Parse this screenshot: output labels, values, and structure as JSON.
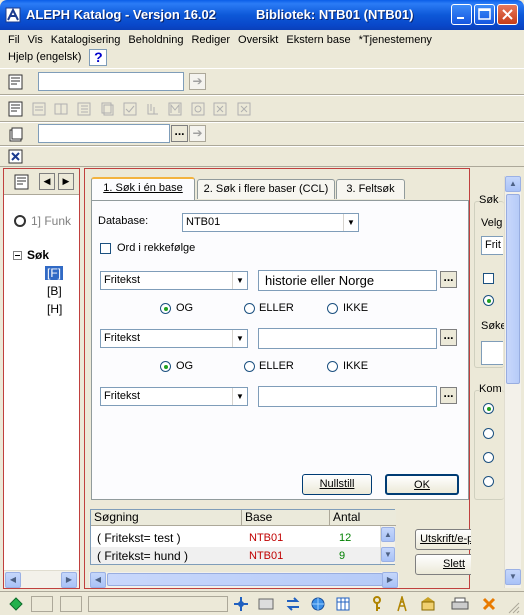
{
  "window": {
    "title": "ALEPH Katalog - Versjon 16.02",
    "library": "Bibliotek:  NTB01 (NTB01)"
  },
  "menu": {
    "items": [
      "Fil",
      "Vis",
      "Katalogisering",
      "Beholdning",
      "Rediger",
      "Oversikt",
      "Ekstern base",
      "*Tjenestemeny"
    ],
    "help": "Hjelp (engelsk)",
    "help_button": "?"
  },
  "left_panel": {
    "func_label": "1] Funk",
    "tree_root": "Søk",
    "tree_items": [
      "[F]",
      "[B]",
      "[H]"
    ]
  },
  "tabs": [
    "1. Søk i én base",
    "2. Søk i flere baser (CCL)",
    "3. Feltsøk"
  ],
  "search_form": {
    "database_label": "Database:",
    "database_value": "NTB01",
    "word_order_label": "Ord i rekkefølge",
    "rows": [
      {
        "field": "Fritekst",
        "value": "historie eller Norge"
      },
      {
        "field": "Fritekst",
        "value": ""
      },
      {
        "field": "Fritekst",
        "value": ""
      }
    ],
    "operators": [
      "OG",
      "ELLER",
      "IKKE"
    ],
    "reset_button": "Nullstill",
    "ok_button": "OK"
  },
  "results": {
    "headers": [
      "Søgning",
      "Base",
      "Antal"
    ],
    "rows": [
      {
        "query": "( Fritekst= test )",
        "base": "NTB01",
        "count": "12"
      },
      {
        "query": "( Fritekst= hund )",
        "base": "NTB01",
        "count": "9"
      }
    ],
    "print_button": "Utskrift/e-post",
    "delete_button": "Slett"
  },
  "right_panel": {
    "group1_title": "Søk",
    "select_label": "Velg",
    "select_value": "Frit",
    "search_label": "Søke",
    "group2_title": "Kom"
  },
  "colors": {
    "base_text": "#c00000",
    "count_text": "#008000"
  }
}
